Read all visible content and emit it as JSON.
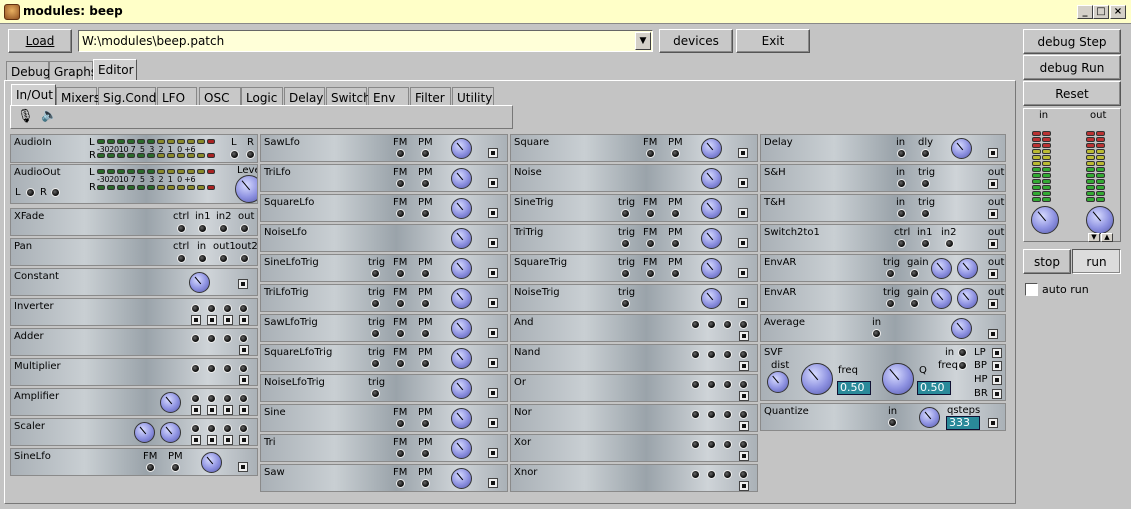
{
  "window": {
    "title": "modules: beep"
  },
  "toolbar": {
    "load_label": "Load",
    "patch_path": "W:\\modules\\beep.patch",
    "devices_label": "devices",
    "exit_label": "Exit"
  },
  "main_tabs": [
    {
      "label": "Debug"
    },
    {
      "label": "Graphs"
    },
    {
      "label": "Editor"
    }
  ],
  "category_tabs": [
    {
      "label": "In/Out"
    },
    {
      "label": "Mixers"
    },
    {
      "label": "Sig.Cond."
    },
    {
      "label": "LFO"
    },
    {
      "label": "OSC"
    },
    {
      "label": "Logic"
    },
    {
      "label": "Delay"
    },
    {
      "label": "Switch"
    },
    {
      "label": "Env"
    },
    {
      "label": "Filter"
    },
    {
      "label": "Utility"
    }
  ],
  "meter_scale": [
    "-30",
    "20",
    "10",
    "7",
    "5",
    "3",
    "2",
    "1",
    "0",
    "+6"
  ],
  "modules": {
    "audioin": {
      "name": "AudioIn",
      "l": "L",
      "r": "R",
      "L2": "L",
      "R2": "R"
    },
    "audioout": {
      "name": "AudioOut",
      "l": "L",
      "r": "R",
      "level": "Level",
      "lsel": "L",
      "rsel": "R"
    },
    "xfade": {
      "name": "XFade",
      "ports": [
        "ctrl",
        "in1",
        "in2",
        "out"
      ]
    },
    "pan": {
      "name": "Pan",
      "ports": [
        "ctrl",
        "in",
        "out1",
        "out2"
      ]
    },
    "constant": {
      "name": "Constant"
    },
    "inverter": {
      "name": "Inverter"
    },
    "adder": {
      "name": "Adder"
    },
    "multiplier": {
      "name": "Multiplier"
    },
    "amplifier": {
      "name": "Amplifier"
    },
    "scaler": {
      "name": "Scaler"
    },
    "sinelfo": {
      "name": "SineLfo",
      "fm": "FM",
      "pm": "PM"
    },
    "col2": [
      {
        "name": "SawLfo",
        "trig": "",
        "fm": "FM",
        "pm": "PM"
      },
      {
        "name": "TriLfo",
        "trig": "",
        "fm": "FM",
        "pm": "PM"
      },
      {
        "name": "SquareLfo",
        "trig": "",
        "fm": "FM",
        "pm": "PM"
      },
      {
        "name": "NoiseLfo",
        "trig": "",
        "fm": "",
        "pm": ""
      },
      {
        "name": "SineLfoTrig",
        "trig": "trig",
        "fm": "FM",
        "pm": "PM"
      },
      {
        "name": "TriLfoTrig",
        "trig": "trig",
        "fm": "FM",
        "pm": "PM"
      },
      {
        "name": "SawLfoTrig",
        "trig": "trig",
        "fm": "FM",
        "pm": "PM"
      },
      {
        "name": "SquareLfoTrig",
        "trig": "trig",
        "fm": "FM",
        "pm": "PM"
      },
      {
        "name": "NoiseLfoTrig",
        "trig": "trig",
        "fm": "",
        "pm": ""
      },
      {
        "name": "Sine",
        "trig": "",
        "fm": "FM",
        "pm": "PM"
      },
      {
        "name": "Tri",
        "trig": "",
        "fm": "FM",
        "pm": "PM"
      },
      {
        "name": "Saw",
        "trig": "",
        "fm": "FM",
        "pm": "PM"
      }
    ],
    "col3": [
      {
        "name": "Square",
        "trig": "",
        "fm": "FM",
        "pm": "PM"
      },
      {
        "name": "Noise",
        "trig": "",
        "fm": "",
        "pm": ""
      },
      {
        "name": "SineTrig",
        "trig": "trig",
        "fm": "FM",
        "pm": "PM"
      },
      {
        "name": "TriTrig",
        "trig": "trig",
        "fm": "FM",
        "pm": "PM"
      },
      {
        "name": "SquareTrig",
        "trig": "trig",
        "fm": "FM",
        "pm": "PM"
      },
      {
        "name": "NoiseTrig",
        "trig": "trig",
        "fm": "",
        "pm": ""
      }
    ],
    "logic": [
      {
        "name": "And"
      },
      {
        "name": "Nand"
      },
      {
        "name": "Or"
      },
      {
        "name": "Nor"
      },
      {
        "name": "Xor"
      },
      {
        "name": "Xnor"
      }
    ],
    "delay": {
      "name": "Delay",
      "in": "in",
      "dly": "dly"
    },
    "sh": {
      "name": "S&H",
      "in": "in",
      "trig": "trig",
      "out": "out"
    },
    "th": {
      "name": "T&H",
      "in": "in",
      "trig": "trig",
      "out": "out"
    },
    "switch2to1": {
      "name": "Switch2to1",
      "ctrl": "ctrl",
      "in1": "in1",
      "in2": "in2",
      "out": "out"
    },
    "envar1": {
      "name": "EnvAR",
      "trig": "trig",
      "gain": "gain",
      "out": "out"
    },
    "envar2": {
      "name": "EnvAR",
      "trig": "trig",
      "gain": "gain",
      "out": "out"
    },
    "average": {
      "name": "Average",
      "in": "in"
    },
    "svf": {
      "name": "SVF",
      "dist": "dist",
      "freq": "freq",
      "q": "Q",
      "in": "in",
      "freq2": "freq",
      "freq_val": "0.50",
      "q_val": "0.50",
      "lp": "LP",
      "bp": "BP",
      "hp": "HP",
      "br": "BR"
    },
    "quantize": {
      "name": "Quantize",
      "in": "in",
      "qsteps": "qsteps",
      "qsteps_val": "333"
    }
  },
  "right_panel": {
    "debug_step": "debug Step",
    "debug_run": "debug Run",
    "reset": "Reset",
    "in_label": "in",
    "out_label": "out",
    "stop": "stop",
    "run": "run",
    "auto_run": "auto run"
  }
}
